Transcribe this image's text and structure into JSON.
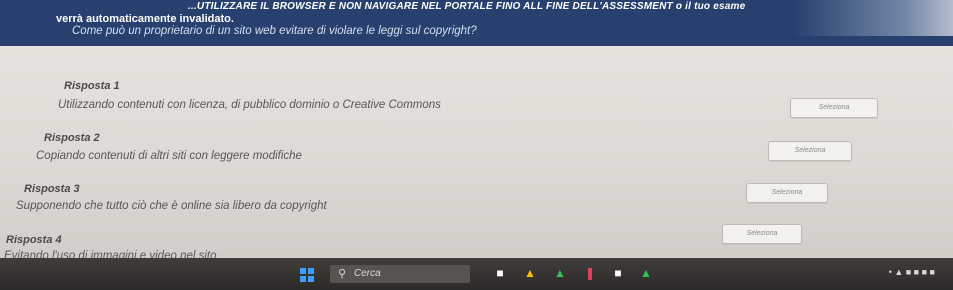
{
  "banner": {
    "line1": "...UTILIZZARE IL BROWSER E NON NAVIGARE NEL PORTALE FINO ALL FINE DELL'ASSESSMENT o il tuo esame",
    "line2": "verrà automaticamente invalidato."
  },
  "question": "Come può un proprietario di un sito web evitare di violare le leggi sul copyright?",
  "answers": [
    {
      "title": "Risposta 1",
      "text": "Utilizzando contenuti con licenza, di pubblico dominio o Creative Commons",
      "button": "Seleziona"
    },
    {
      "title": "Risposta 2",
      "text": "Copiando contenuti di altri siti con leggere modifiche",
      "button": "Seleziona"
    },
    {
      "title": "Risposta 3",
      "text": "Supponendo che tutto ciò che è online sia libero da copyright",
      "button": "Seleziona"
    },
    {
      "title": "Risposta 4",
      "text": "Evitando l'uso di immagini e video nel sito",
      "button": "Seleziona"
    }
  ],
  "taskbar": {
    "search_label": "Cerca",
    "icons": [
      "windows-start-icon",
      "search-icon",
      "file-explorer-icon",
      "browser-icon",
      "store-icon",
      "app-icon"
    ],
    "colors": {
      "start": "#3aa0ff",
      "banner": "#27406e"
    }
  }
}
